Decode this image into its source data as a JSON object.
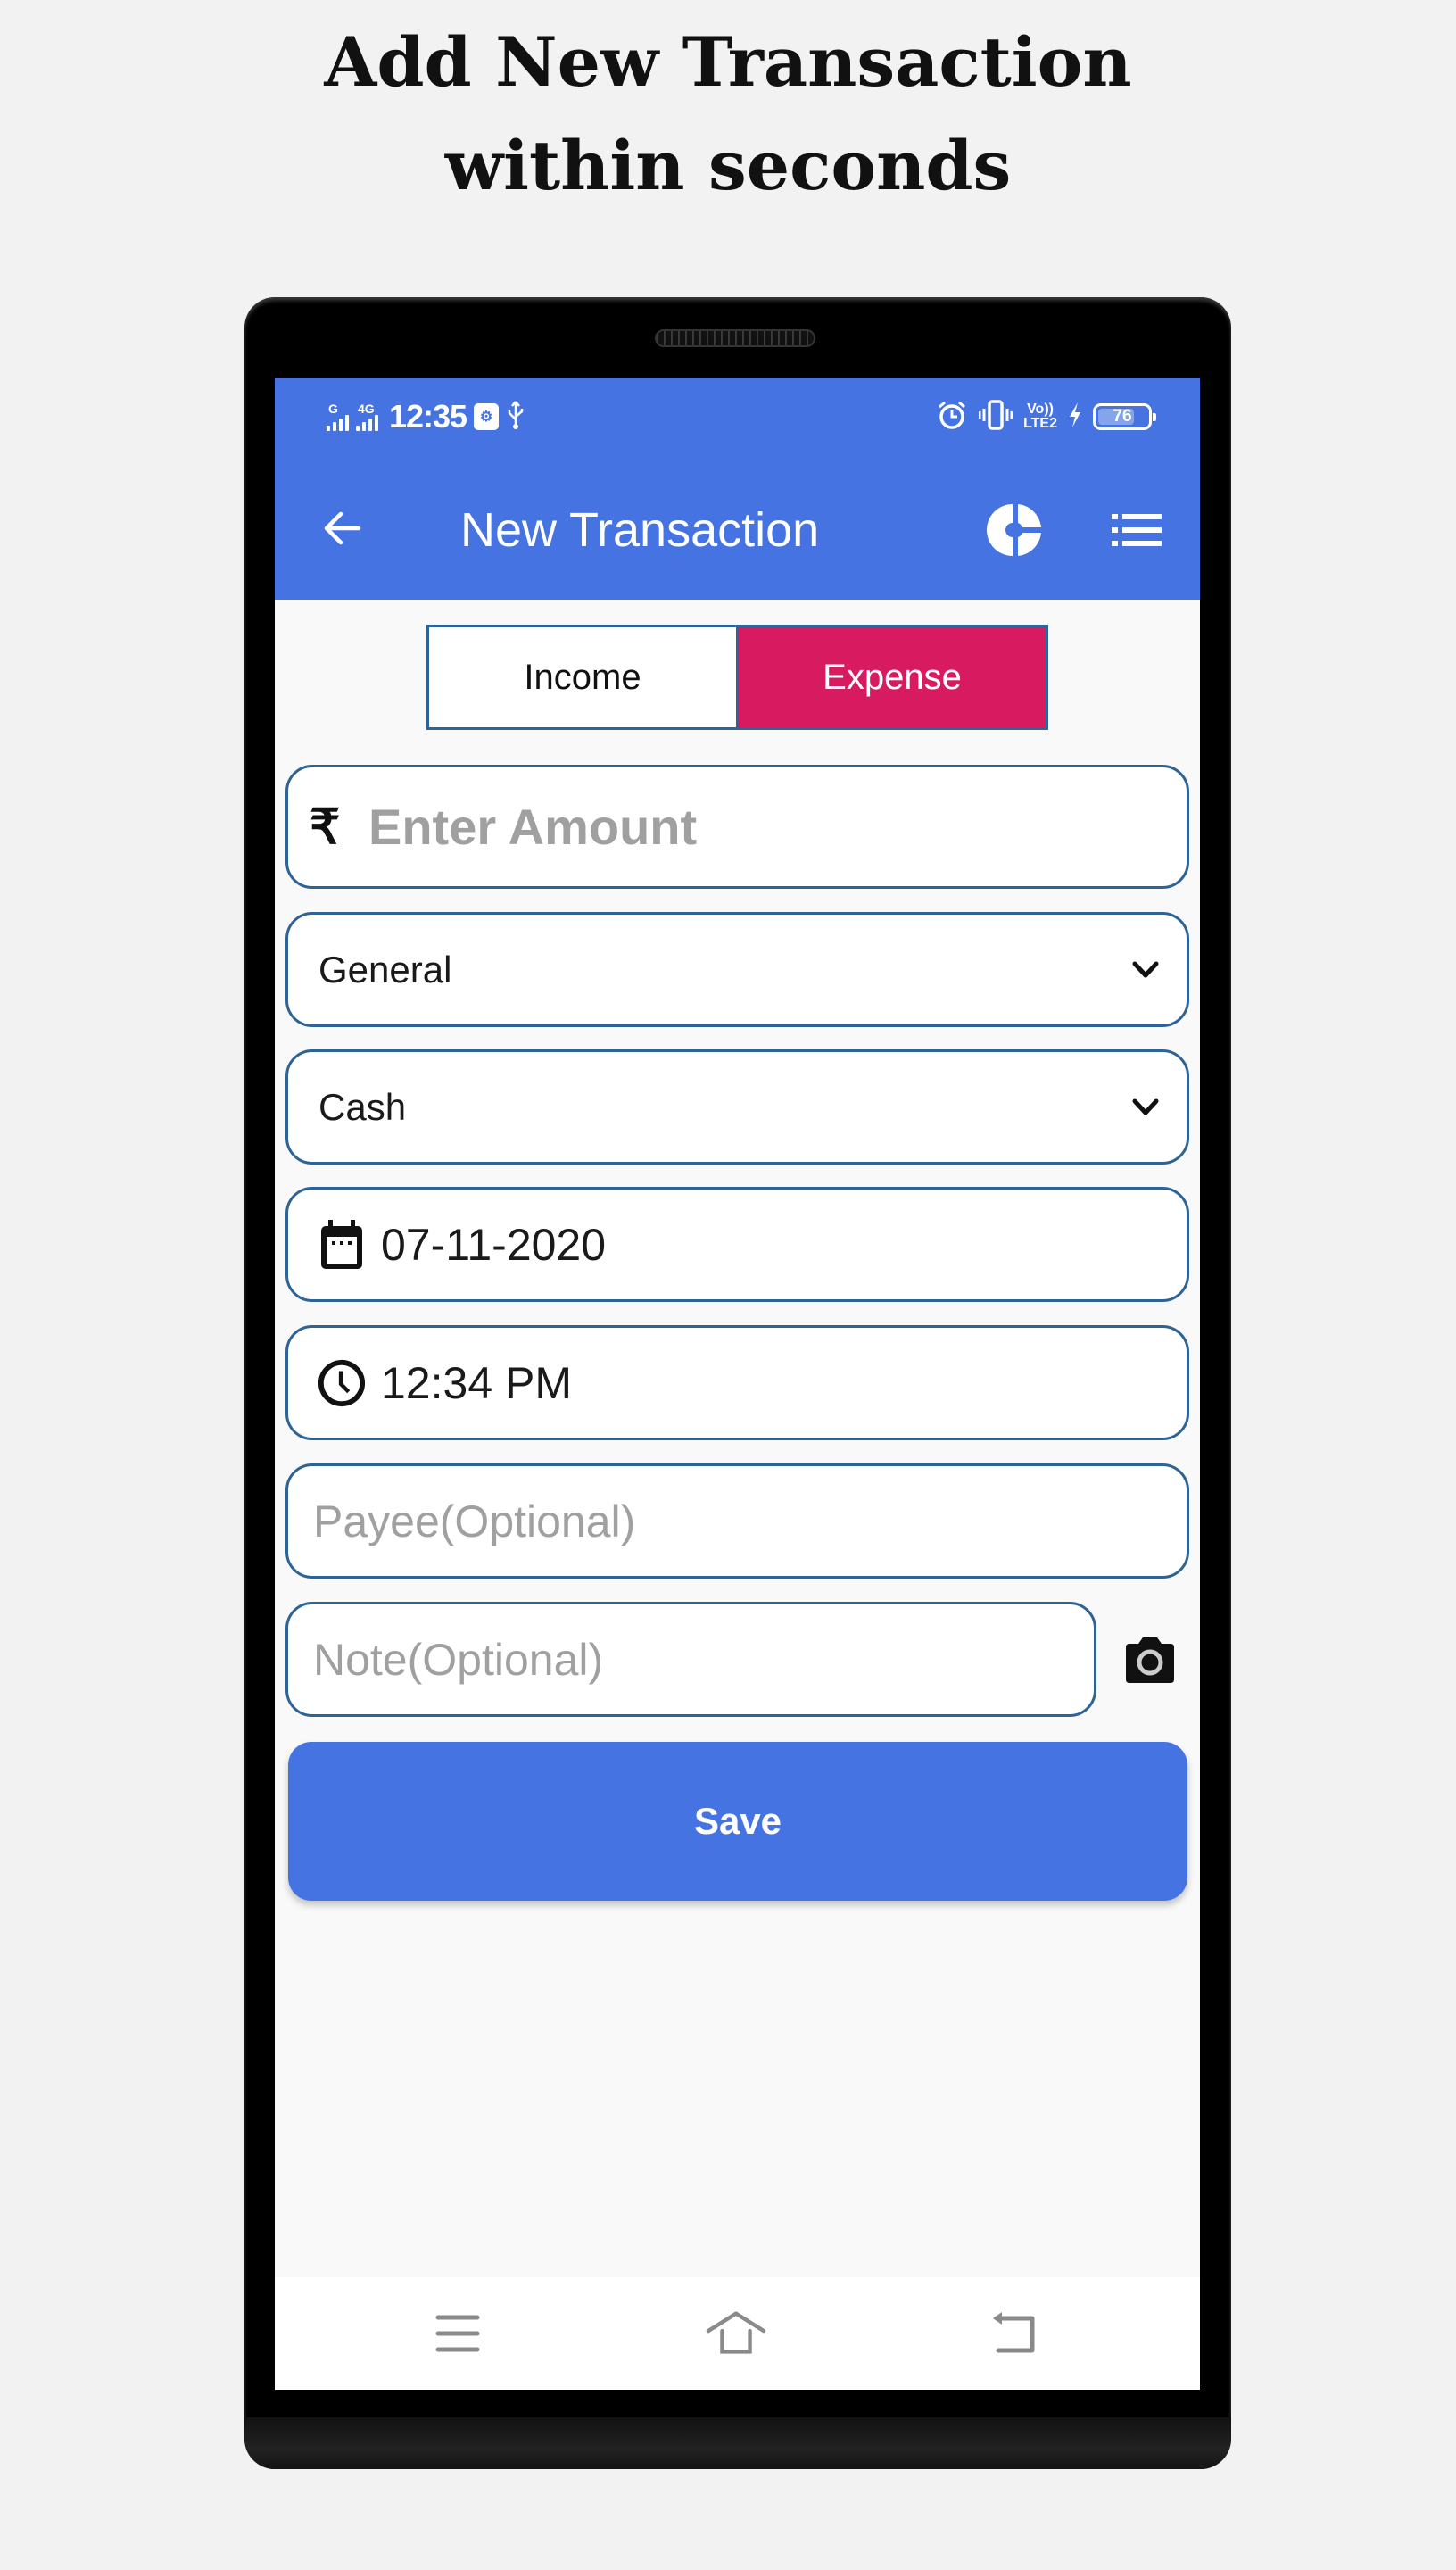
{
  "headline": {
    "line1": "Add New Transaction",
    "line2": "within seconds"
  },
  "status_bar": {
    "sim1_label": "G",
    "sim2_label": "4G",
    "time": "12:35",
    "volte_line1": "Vo))",
    "volte_line2": "LTE2",
    "battery_level": "76",
    "battery_fraction": 0.76,
    "icons": [
      "signal-icon",
      "signal-icon",
      "usb-settings-icon",
      "usb-icon",
      "alarm-icon",
      "vibrate-icon",
      "volte-icon",
      "charging-icon",
      "battery-icon"
    ]
  },
  "app_bar": {
    "title": "New Transaction",
    "back_icon": "arrow-left-icon",
    "chart_icon": "pie-chart-icon",
    "list_icon": "list-icon"
  },
  "type_toggle": {
    "options": [
      "Income",
      "Expense"
    ],
    "selected": "Expense"
  },
  "form": {
    "currency_symbol": "₹",
    "amount_placeholder": "Enter Amount",
    "category": "General",
    "account": "Cash",
    "date": "07-11-2020",
    "time": "12:34 PM",
    "payee_placeholder": "Payee(Optional)",
    "note_placeholder": "Note(Optional)"
  },
  "save_label": "Save",
  "colors": {
    "primary": "#4673e2",
    "expense_accent": "#d81b60",
    "field_border": "#2e6397"
  },
  "nav_bar": {
    "icons": [
      "menu-icon",
      "home-icon",
      "back-icon"
    ]
  }
}
